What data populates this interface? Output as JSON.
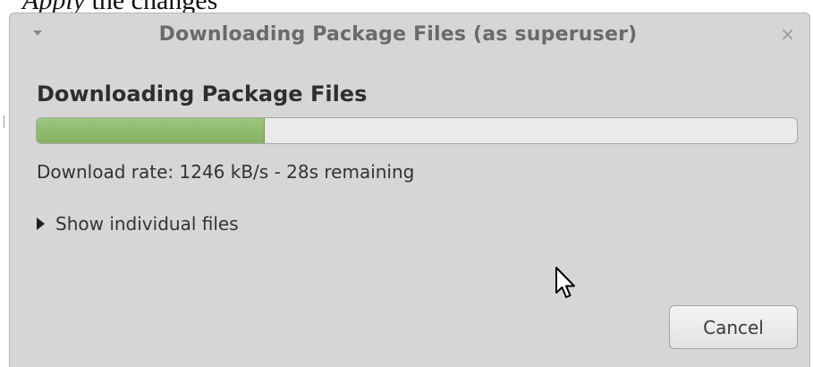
{
  "document": {
    "heading_italic": "Apply",
    "heading_rest": " the changes"
  },
  "dialog": {
    "title": "Downloading Package Files (as superuser)",
    "menu_icon": "window-menu-icon",
    "close_icon": "close-icon",
    "close_glyph": "×",
    "heading": "Downloading Package Files",
    "progress": {
      "fraction": 0.3
    },
    "status": "Download rate: 1246 kB/s - 28s remaining",
    "expander_label": "Show individual files",
    "cancel_label": "Cancel"
  },
  "colors": {
    "dialog_bg": "#d6d6d6",
    "progress_fill": "#8fbc6c",
    "progress_trough": "#eaeaea"
  }
}
